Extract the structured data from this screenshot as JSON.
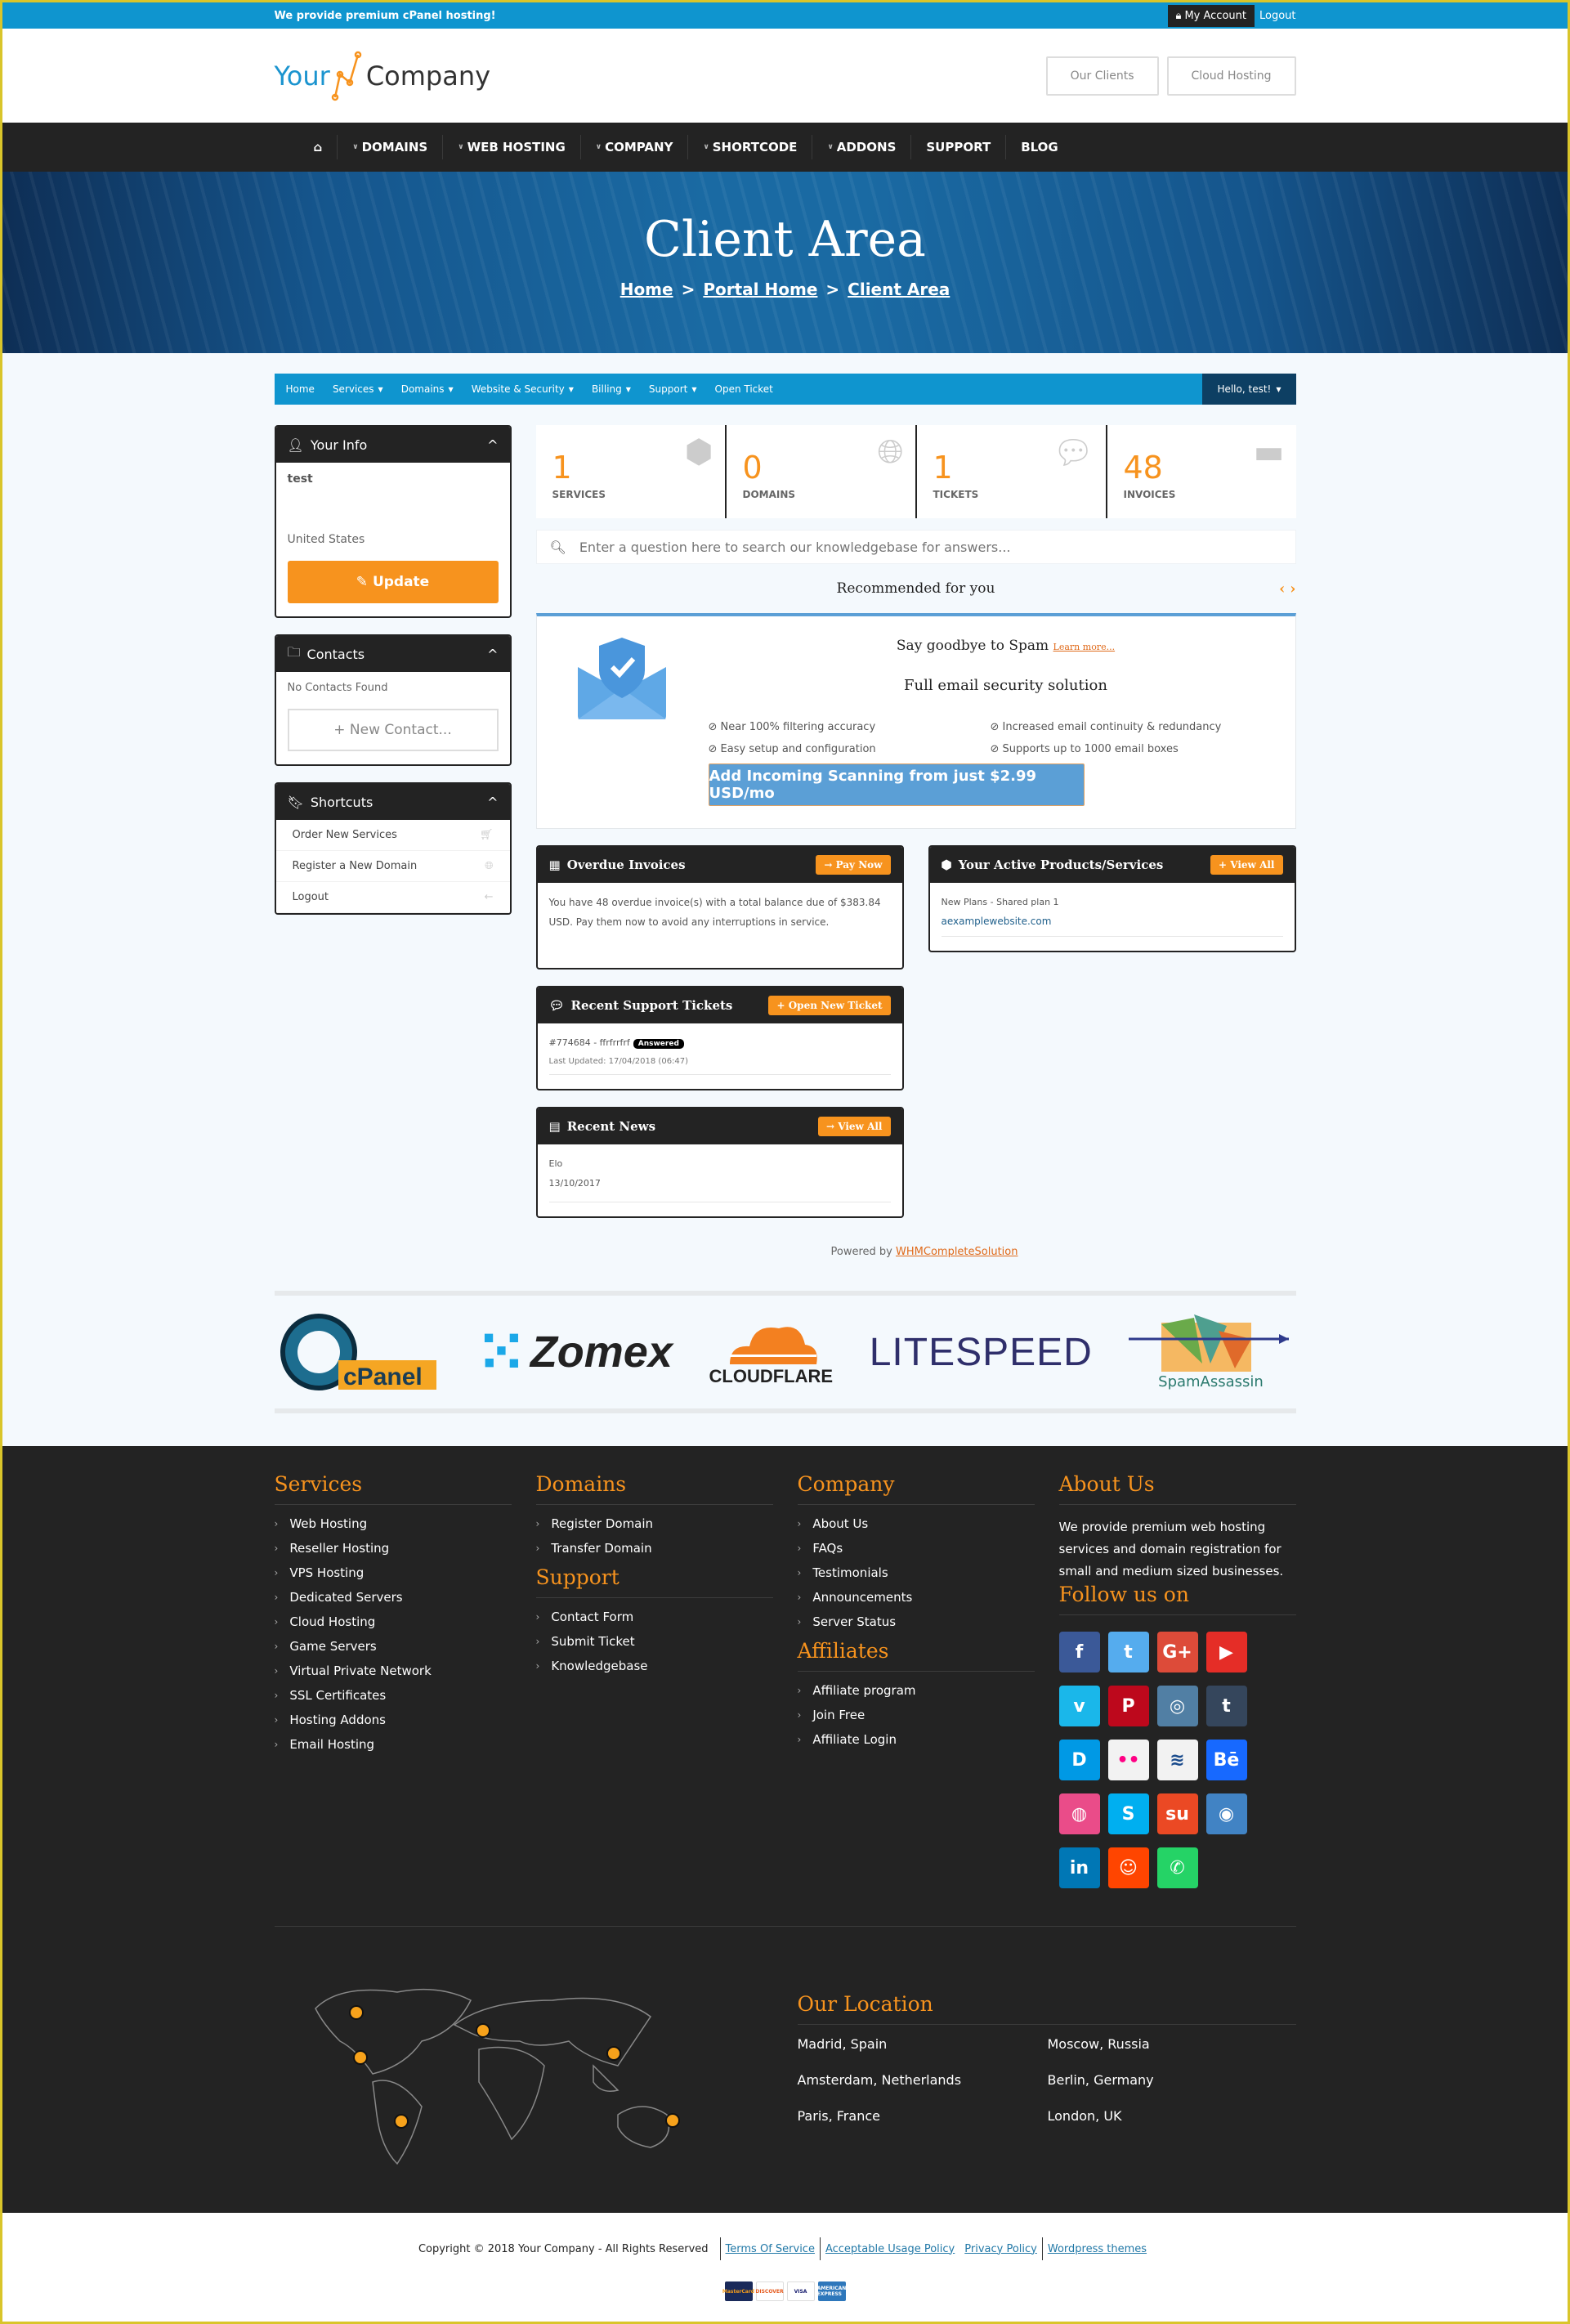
{
  "topbar": {
    "promo": "We provide premium cPanel hosting!",
    "my_account": "My Account",
    "logout": "Logout"
  },
  "header": {
    "logo_your": "Your",
    "logo_company": "Company",
    "buttons": [
      "Our Clients",
      "Cloud Hosting"
    ]
  },
  "mainnav": {
    "items": [
      {
        "label": "DOMAINS",
        "dropdown": true
      },
      {
        "label": "WEB HOSTING",
        "dropdown": true
      },
      {
        "label": "COMPANY",
        "dropdown": true
      },
      {
        "label": "SHORTCODE",
        "dropdown": true
      },
      {
        "label": "ADDONS",
        "dropdown": true
      },
      {
        "label": "SUPPORT",
        "dropdown": false
      },
      {
        "label": "BLOG",
        "dropdown": false
      }
    ]
  },
  "hero": {
    "title": "Client Area",
    "breadcrumb": [
      "Home",
      "Portal Home",
      "Client Area"
    ],
    "separator": ">"
  },
  "clientnav": {
    "items": [
      "Home",
      "Services",
      "Domains",
      "Website & Security",
      "Billing",
      "Support",
      "Open Ticket"
    ],
    "hello": "Hello, test!"
  },
  "sidebar": {
    "your_info": {
      "title": "Your Info",
      "name": "test",
      "country": "United States",
      "update_label": "Update"
    },
    "contacts": {
      "title": "Contacts",
      "empty": "No Contacts Found",
      "new_label": "New Contact..."
    },
    "shortcuts": {
      "title": "Shortcuts",
      "items": [
        {
          "label": "Order New Services",
          "icon": "cart-icon"
        },
        {
          "label": "Register a New Domain",
          "icon": "globe-icon"
        },
        {
          "label": "Logout",
          "icon": "arrow-left-icon"
        }
      ]
    }
  },
  "stats": [
    {
      "value": "1",
      "label": "SERVICES",
      "icon": "cube-icon"
    },
    {
      "value": "0",
      "label": "DOMAINS",
      "icon": "globe-icon"
    },
    {
      "value": "1",
      "label": "TICKETS",
      "icon": "comments-icon"
    },
    {
      "value": "48",
      "label": "INVOICES",
      "icon": "credit-card-icon"
    }
  ],
  "search": {
    "placeholder": "Enter a question here to search our knowledgebase for answers..."
  },
  "recommended": {
    "title": "Recommended for you",
    "headline": "Say goodbye to Spam",
    "learn_more": "Learn more...",
    "subtitle": "Full email security solution",
    "features": [
      "Near 100% filtering accuracy",
      "Increased email continuity & redundancy",
      "Easy setup and configuration",
      "Supports up to 1000 email boxes"
    ],
    "cta": "Add Incoming Scanning from just $2.99 USD/mo"
  },
  "overdue": {
    "title": "Overdue Invoices",
    "button": "Pay Now",
    "text": "You have 48 overdue invoice(s) with a total balance due of $383.84 USD. Pay them now to avoid any interruptions in service."
  },
  "active_products": {
    "title": "Your Active Products/Services",
    "button": "View All",
    "product": "New Plans - Shared plan 1",
    "domain": "aexamplewebsite.com"
  },
  "tickets": {
    "title": "Recent Support Tickets",
    "button": "Open New Ticket",
    "ticket": "#774684 - ffrfrrfrf",
    "status": "Answered",
    "updated": "Last Updated: 17/04/2018 (06:47)"
  },
  "news": {
    "title": "Recent News",
    "button": "View All",
    "item_title": "Elo",
    "item_date": "13/10/2017"
  },
  "powered": {
    "prefix": "Powered by",
    "link": "WHMCompleteSolution"
  },
  "partners": [
    "cPanel",
    "Zomex",
    "CLOUDFLARE",
    "LITESPEED",
    "SpamAssassin"
  ],
  "footer": {
    "services": {
      "title": "Services",
      "items": [
        "Web Hosting",
        "Reseller Hosting",
        "VPS Hosting",
        "Dedicated Servers",
        "Cloud Hosting",
        "Game Servers",
        "Virtual Private Network",
        "SSL Certificates",
        "Hosting Addons",
        "Email Hosting"
      ]
    },
    "domains": {
      "title": "Domains",
      "items": [
        "Register Domain",
        "Transfer Domain"
      ]
    },
    "support": {
      "title": "Support",
      "items": [
        "Contact Form",
        "Submit Ticket",
        "Knowledgebase"
      ]
    },
    "company": {
      "title": "Company",
      "items": [
        "About Us",
        "FAQs",
        "Testimonials",
        "Announcements",
        "Server Status"
      ]
    },
    "affiliates": {
      "title": "Affiliates",
      "items": [
        "Affiliate program",
        "Join Free",
        "Affiliate Login"
      ]
    },
    "about": {
      "title": "About Us",
      "text": "We provide premium web hosting services and domain registration for small and medium sized businesses."
    },
    "follow": {
      "title": "Follow us on",
      "networks": [
        {
          "name": "facebook",
          "glyph": "f",
          "color": "#3b5998"
        },
        {
          "name": "twitter",
          "glyph": "t",
          "color": "#55acee"
        },
        {
          "name": "google-plus",
          "glyph": "G+",
          "color": "#dd4b39"
        },
        {
          "name": "youtube",
          "glyph": "▶",
          "color": "#e52d27"
        },
        {
          "name": "vimeo",
          "glyph": "v",
          "color": "#1ab7ea"
        },
        {
          "name": "pinterest",
          "glyph": "P",
          "color": "#bd081c"
        },
        {
          "name": "instagram",
          "glyph": "◎",
          "color": "#517fa4"
        },
        {
          "name": "tumblr",
          "glyph": "t",
          "color": "#35465c"
        },
        {
          "name": "dailymotion",
          "glyph": "D",
          "color": "#0099e5"
        },
        {
          "name": "flickr",
          "glyph": "••",
          "color": "#f2f2f2"
        },
        {
          "name": "steem",
          "glyph": "≋",
          "color": "#f2f2f2"
        },
        {
          "name": "behance",
          "glyph": "Bē",
          "color": "#1769ff"
        },
        {
          "name": "dribbble",
          "glyph": "◍",
          "color": "#ea4c89"
        },
        {
          "name": "skype",
          "glyph": "S",
          "color": "#00aff0"
        },
        {
          "name": "stumbleupon",
          "glyph": "su",
          "color": "#eb4924"
        },
        {
          "name": "github",
          "glyph": "◉",
          "color": "#4183c4"
        },
        {
          "name": "linkedin",
          "glyph": "in",
          "color": "#0077b5"
        },
        {
          "name": "reddit",
          "glyph": "☺",
          "color": "#ff4500"
        },
        {
          "name": "whatsapp",
          "glyph": "✆",
          "color": "#25d366"
        }
      ]
    },
    "location": {
      "title": "Our Location",
      "cities": [
        "Madrid, Spain",
        "Moscow, Russia",
        "Amsterdam, Netherlands",
        "Berlin, Germany",
        "Paris, France",
        "London, UK"
      ]
    }
  },
  "bottom": {
    "copyright": "Copyright © 2018 Your Company - All Rights Reserved",
    "links": [
      "Terms Of Service",
      "Acceptable Usage Policy",
      "Privacy Policy",
      "Wordpress themes"
    ],
    "cards": [
      "MasterCard",
      "DISCOVER",
      "VISA",
      "AMERICAN EXPRESS"
    ]
  },
  "colors": {
    "accent": "#f7931e",
    "primary": "#0f95cf",
    "dark": "#232323"
  }
}
